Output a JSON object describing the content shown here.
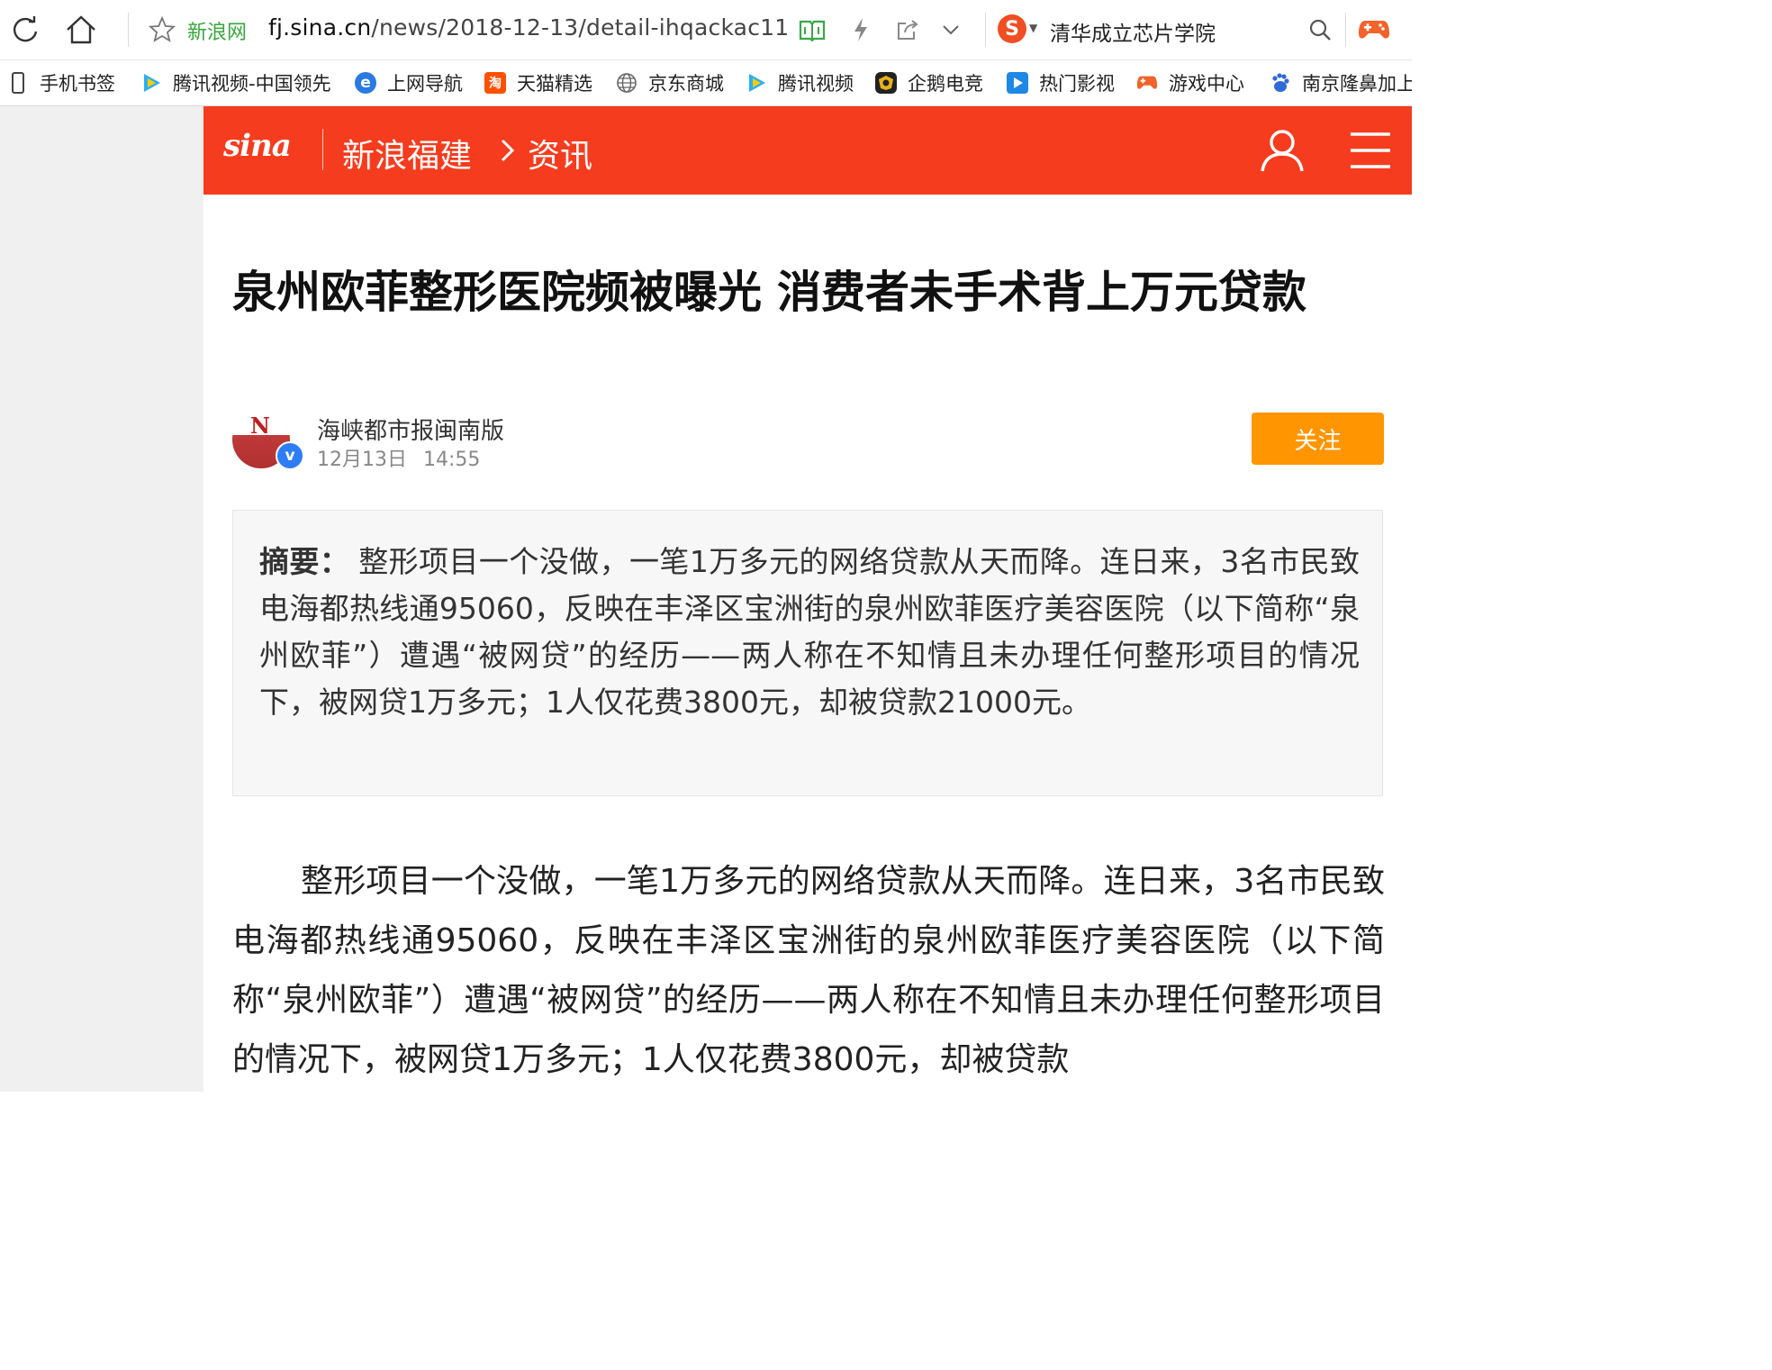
{
  "browser": {
    "site_tag": "新浪网",
    "url_host": "fj.sina.cn",
    "url_path": "/news/2018-12-13/detail-ihqackac11",
    "search_engine_glyph": "S",
    "search_query": "清华成立芯片学院"
  },
  "bookmarks": [
    {
      "label": "手机书签",
      "icon": "phone-icon"
    },
    {
      "label": "腾讯视频-中国领先",
      "icon": "tencent-video-icon"
    },
    {
      "label": "上网导航",
      "icon": "ie-icon"
    },
    {
      "label": "天猫精选",
      "icon": "taobao-icon"
    },
    {
      "label": "京东商城",
      "icon": "globe-icon"
    },
    {
      "label": "腾讯视频",
      "icon": "tencent-video-icon"
    },
    {
      "label": "企鹅电竞",
      "icon": "penguin-esports-icon"
    },
    {
      "label": "热门影视",
      "icon": "play-icon"
    },
    {
      "label": "游戏中心",
      "icon": "gamepad-icon"
    },
    {
      "label": "南京隆鼻加上",
      "icon": "baidu-icon"
    }
  ],
  "header": {
    "logo": "sina",
    "channel": "新浪福建",
    "section": "资讯"
  },
  "article": {
    "headline": "泉州欧菲整形医院频被曝光 消费者未手术背上万元贷款",
    "author": "海峡都市报闽南版",
    "date": "12月13日",
    "time": "14:55",
    "follow_label": "关注",
    "summary_label": "摘要：",
    "summary": "整形项目一个没做，一笔1万多元的网络贷款从天而降。连日来，3名市民致电海都热线通95060，反映在丰泽区宝洲街的泉州欧菲医疗美容医院（以下简称“泉州欧菲”）遭遇“被网贷”的经历——两人称在不知情且未办理任何整形项目的情况下，被网贷1万多元；1人仅花费3800元，却被贷款21000元。",
    "body": "整形项目一个没做，一笔1万多元的网络贷款从天而降。连日来，3名市民致电海都热线通95060，反映在丰泽区宝洲街的泉州欧菲医疗美容医院（以下简称“泉州欧菲”）遭遇“被网贷”的经历——两人称在不知情且未办理任何整形项目的情况下，被网贷1万多元；1人仅花费3800元，却被贷款"
  },
  "colors": {
    "header_red": "#f63c1e",
    "follow_orange": "#ff9500",
    "verified_blue": "#2f7df6",
    "site_tag_green": "#37a63c"
  }
}
